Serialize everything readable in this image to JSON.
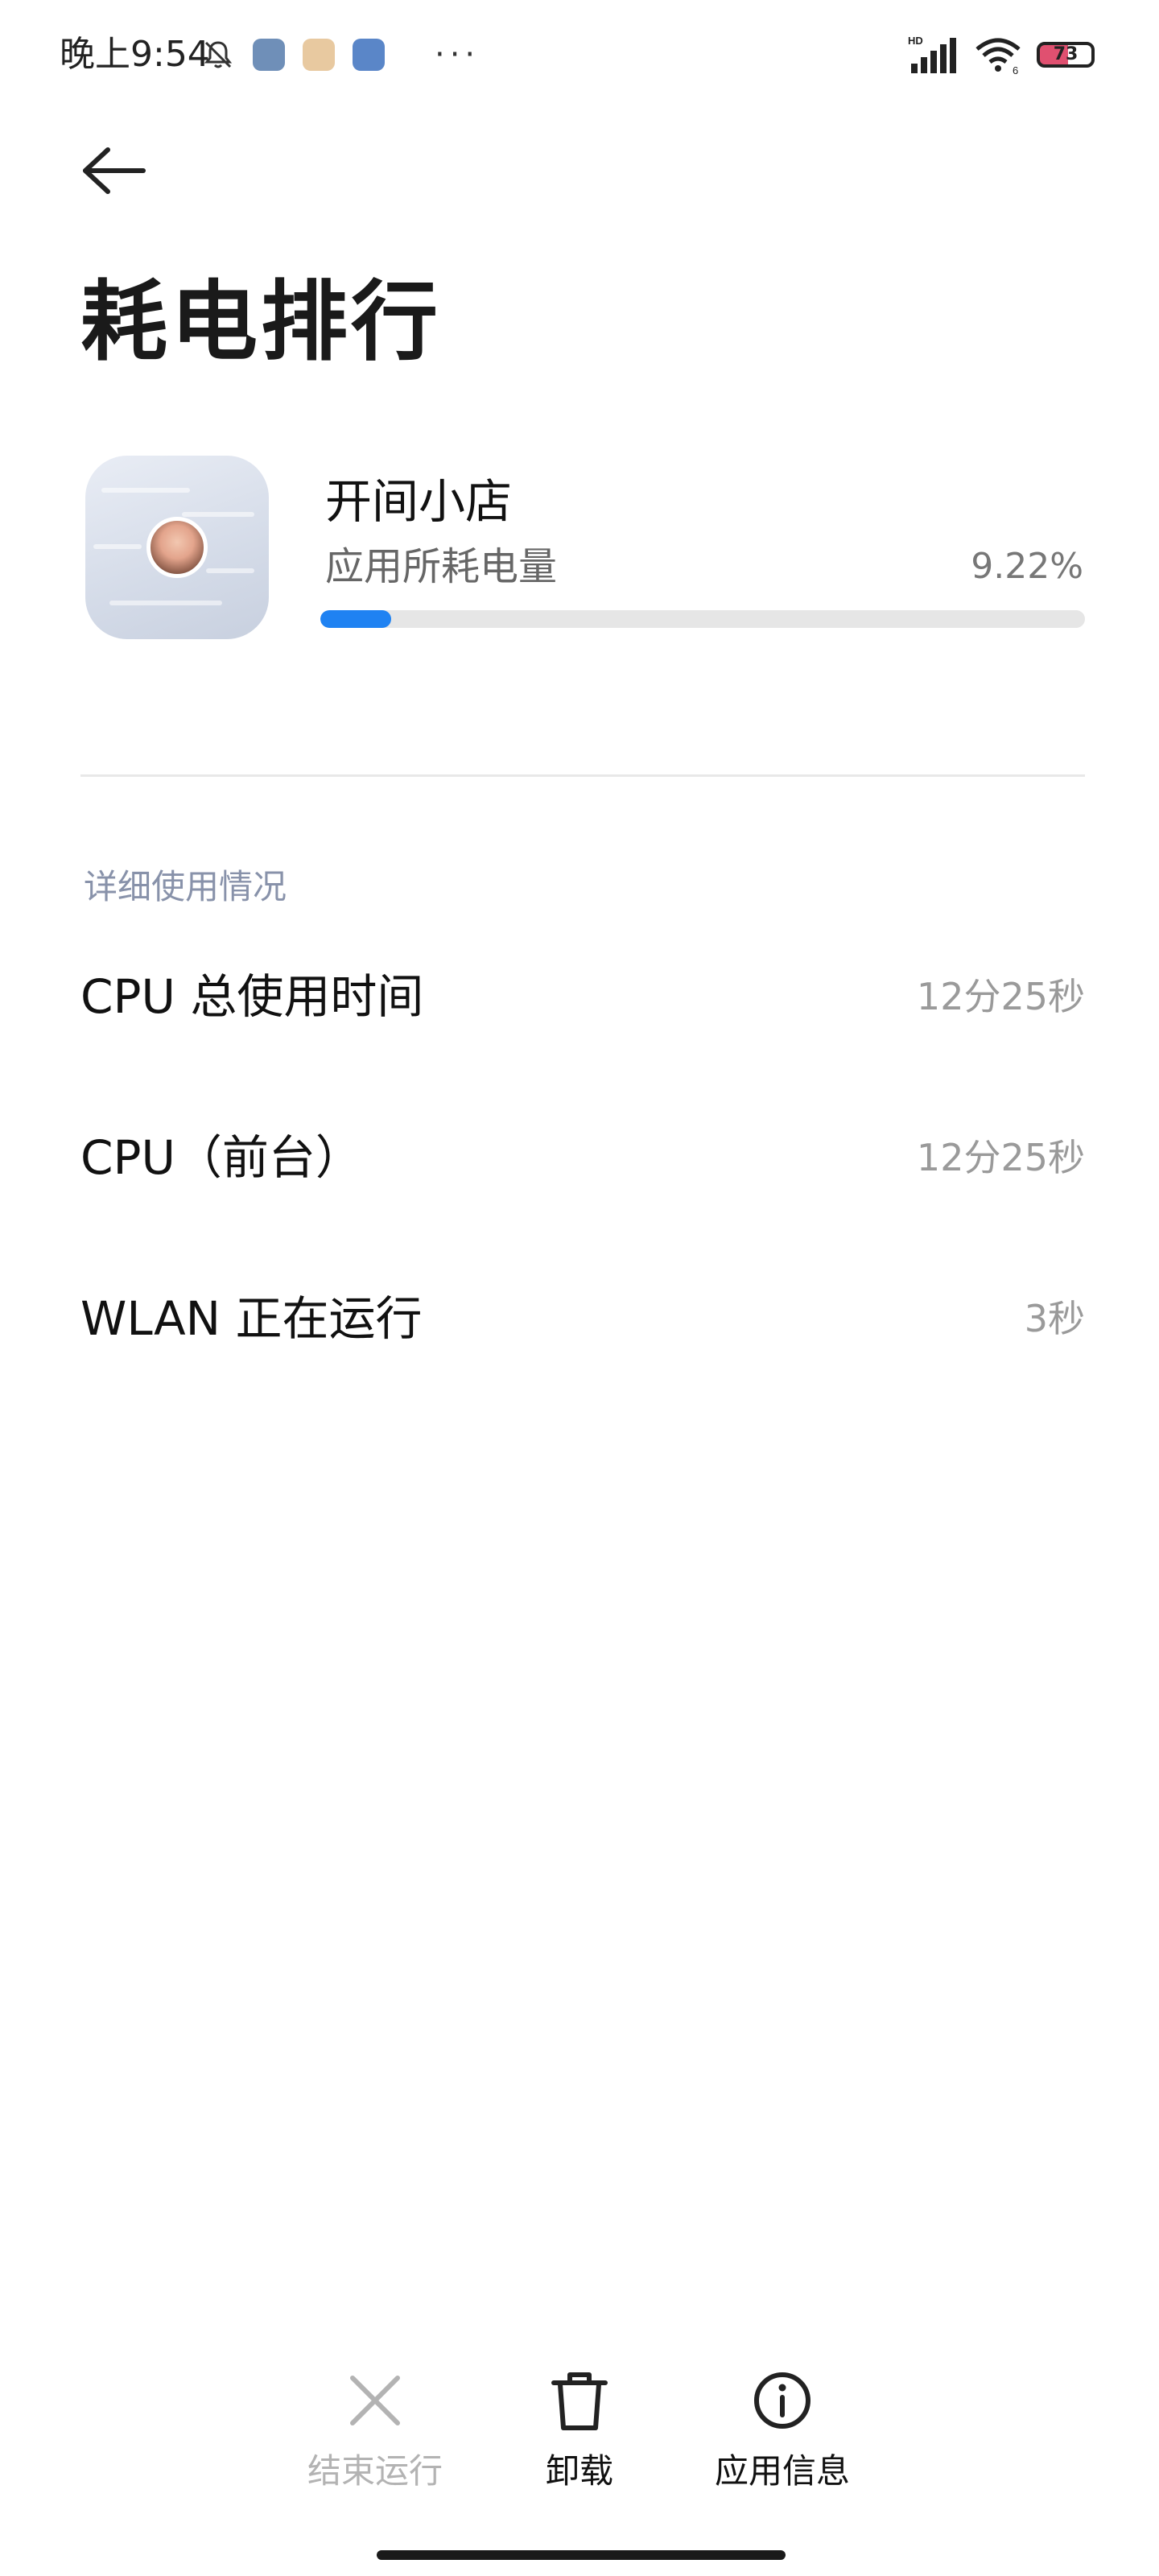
{
  "status_bar": {
    "time": "晚上9:54",
    "dots": "···",
    "network_badge": "HD",
    "wifi_badge": "6",
    "battery_level": "73"
  },
  "icons": {
    "back": "arrow-left-icon",
    "mute": "bell-off-icon",
    "kill": "close-icon",
    "uninstall": "trash-icon",
    "info": "info-circle-icon"
  },
  "header": {
    "title": "耗电排行"
  },
  "app": {
    "name": "开间小店",
    "usage_label": "应用所耗电量",
    "usage_percent_text": "9.22%",
    "usage_fraction": 0.0922
  },
  "details": {
    "section_title": "详细使用情况",
    "rows": [
      {
        "label": "CPU 总使用时间",
        "value": "12分25秒"
      },
      {
        "label": "CPU（前台）",
        "value": "12分25秒"
      },
      {
        "label": "WLAN 正在运行",
        "value": "3秒"
      }
    ]
  },
  "actions": {
    "kill_label": "结束运行",
    "uninstall_label": "卸载",
    "info_label": "应用信息"
  },
  "colors": {
    "accent": "#1f82f2",
    "section_header": "#8892aa",
    "disabled": "#b3b3b3"
  }
}
